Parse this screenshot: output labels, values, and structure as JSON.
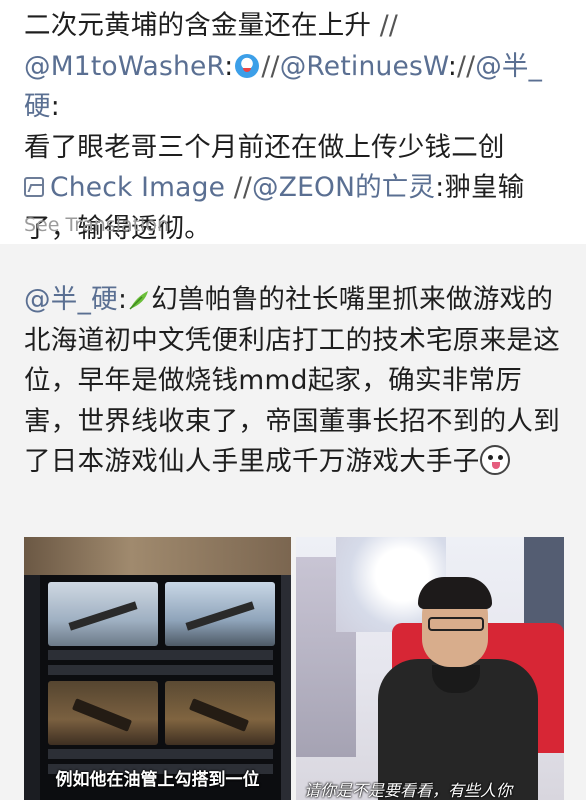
{
  "post1": {
    "line_text_a": "二次元黄埔的含金量还在上升",
    "sep1": "//",
    "mention1": "@M1toWasheR",
    "colon": ":",
    "sep2": "//",
    "mention2": "@RetinuesW",
    "sep3": "//",
    "mention3": "@半_硬",
    "text_b": "看了眼老哥三个月前还在做上传少钱二创",
    "check_image": "Check Image",
    "sep4": "//",
    "mention4": "@ZEON的亡灵",
    "text_c": "翀皇输了，输得透彻。",
    "see_translation": "See Translation",
    "emoji1_icon": "cat-face-emoji-icon",
    "image_icon": "image-icon"
  },
  "post2": {
    "mention": "@半_硬",
    "colon": ":",
    "text": "幻兽帕鲁的社长嘴里抓来做游戏的北海道初中文凭便利店打工的技术宅原来是这位，早年是做烧钱mmd起家，确实非常厉害，世界线收束了，帝国董事长招不到的人到了日本游戏仙人手里成千万游戏大手子",
    "emoji_leaf_icon": "leaf-emoji-icon",
    "emoji_dog_icon": "dog-face-emoji-icon"
  },
  "images": {
    "left_subtitle": "例如他在油管上勾搭到一位",
    "right_subtitle": "请你是不是要看看，有些人你"
  },
  "colors": {
    "mention": "#5a6f92",
    "background": "#f3f3f3",
    "card": "#ffffff",
    "muted": "#9b9b9b"
  }
}
